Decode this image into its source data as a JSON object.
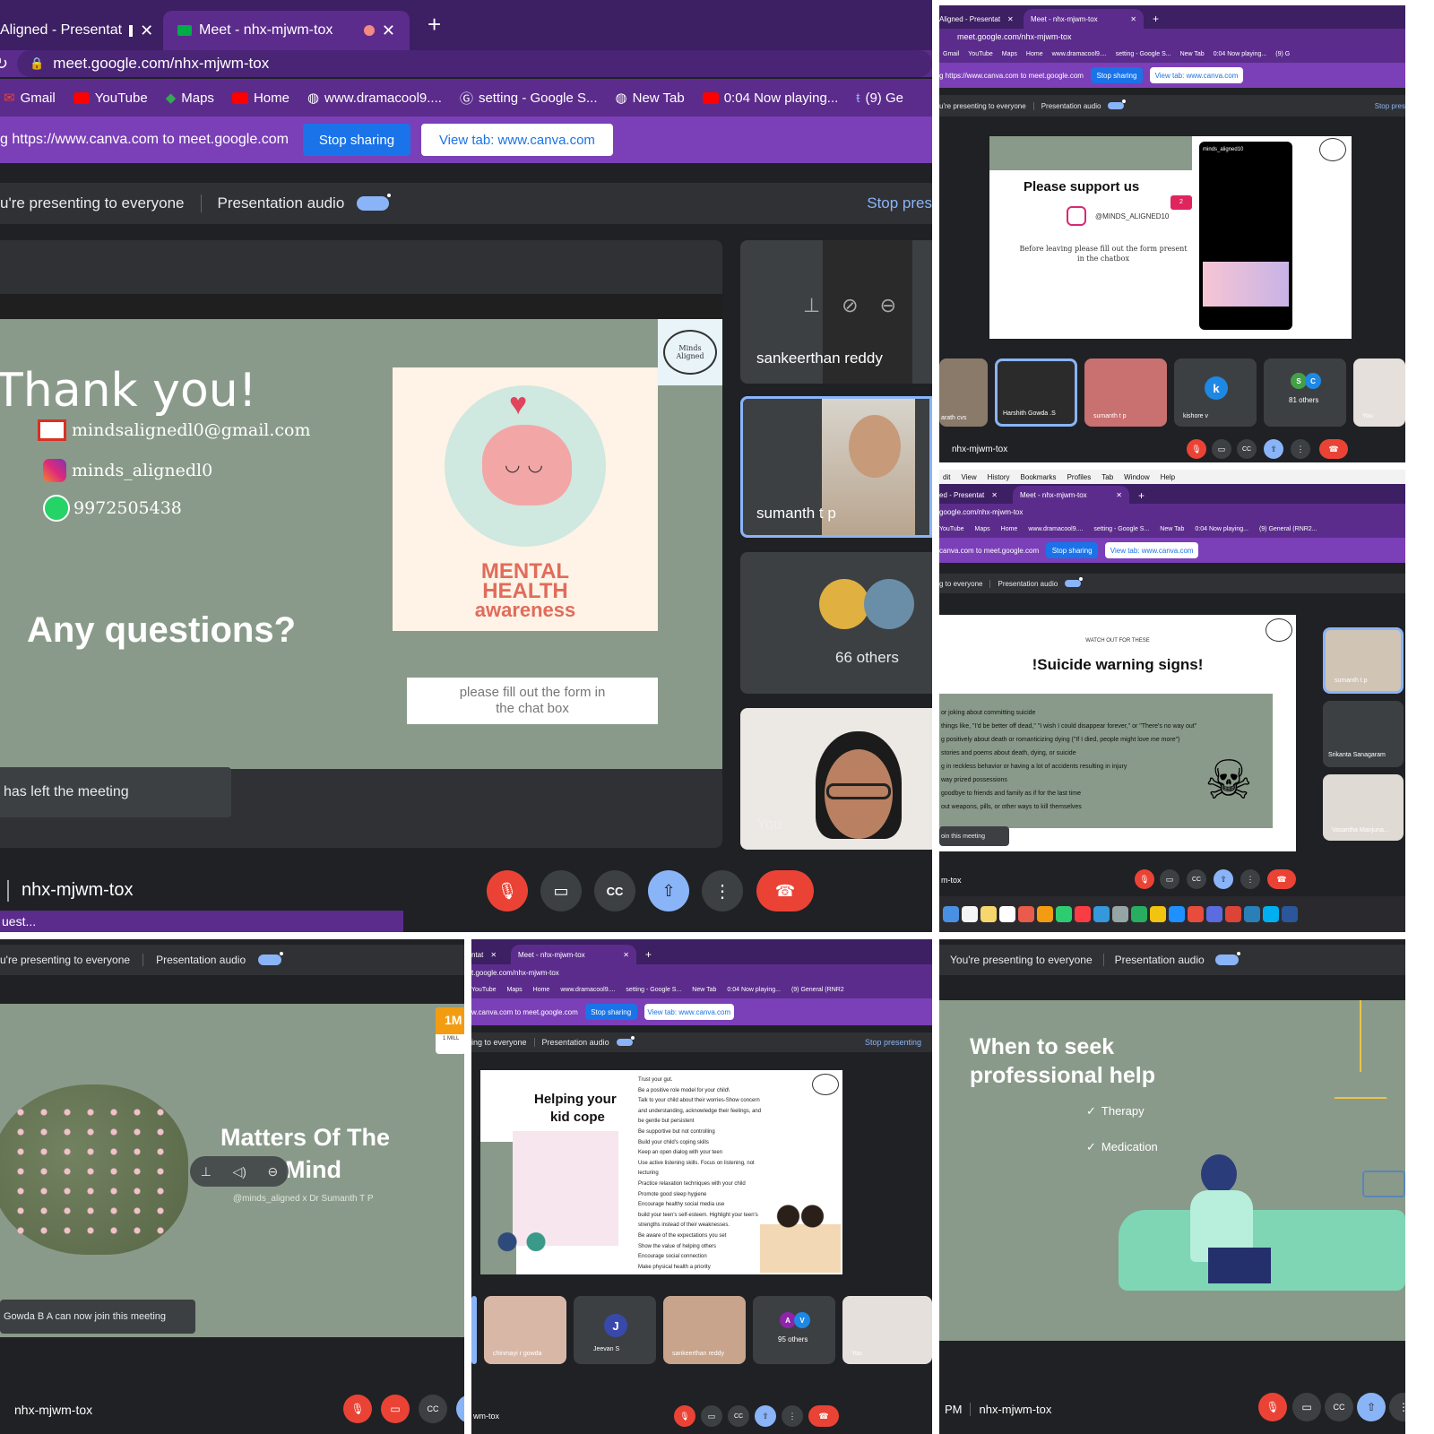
{
  "colors": {
    "purple": "#5b2c8c",
    "meet_dark": "#202124",
    "tile": "#3c4043",
    "slide_green": "#8a9a8a",
    "accent_blue": "#1a73e8",
    "danger_red": "#ea4335"
  },
  "main": {
    "tabs": [
      {
        "label": "Aligned - Presentat",
        "icon": "monitor-icon"
      },
      {
        "label": "Meet - nhx-mjwm-tox",
        "icon": "recording-dot-icon"
      }
    ],
    "new_tab": "+",
    "url": "meet.google.com/nhx-mjwm-tox",
    "bookmarks": [
      "Gmail",
      "YouTube",
      "Maps",
      "Home",
      "www.dramacool9....",
      "setting - Google S...",
      "New Tab",
      "0:04 Now playing...",
      "(9) Ge"
    ],
    "share_text": "g https://www.canva.com to meet.google.com",
    "stop_sharing": "Stop sharing",
    "view_tab": "View tab: www.canva.com",
    "presenting": "u're presenting to everyone",
    "presentation_audio": "Presentation audio",
    "stop_presenting": "Stop pres",
    "slide": {
      "thank_you": "Thank you!",
      "email": "mindsalignedl0@gmail.com",
      "instagram": "minds_alignedl0",
      "phone": "9972505438",
      "questions": "Any questions?",
      "mh_line1": "MENTAL",
      "mh_line2": "HEALTH",
      "mh_line3": "awareness",
      "form_line1": "please fill out the form in",
      "form_line2": "the chat box",
      "logo": "Minds Aligned"
    },
    "toast": "has left the meeting",
    "participants": [
      {
        "name": "sankeerthan reddy"
      },
      {
        "name": "sumanth t p"
      },
      {
        "name": "66 others"
      },
      {
        "name": "You"
      }
    ],
    "meeting_code": "nhx-mjwm-tox",
    "bottom_strip": "uest..."
  },
  "top_right": {
    "tabs": [
      "Aligned - Presentat",
      "Meet - nhx-mjwm-tox"
    ],
    "url": "meet.google.com/nhx-mjwm-tox",
    "bookmarks": [
      "Gmail",
      "YouTube",
      "Maps",
      "Home",
      "www.dramacool9....",
      "setting - Google S...",
      "New Tab",
      "0:04 Now playing...",
      "(9) G"
    ],
    "share_text": "g https://www.canva.com to meet.google.com",
    "stop_sharing": "Stop sharing",
    "view_tab": "View tab: www.canva.com",
    "presenting": "u're presenting to everyone",
    "presentation_audio": "Presentation audio",
    "stop_presenting": "Stop pres",
    "slide_title": "Please support us",
    "handle": "@MINDS_ALIGNED10",
    "note_line1": "Before leaving please fill out the form present",
    "note_line2": "in the chatbox",
    "profile_name": "minds_aligned10",
    "participants": [
      "arath cvs",
      "Harshith Gowda .S",
      "sumanth t p",
      "kishore v",
      "81 others",
      "You"
    ],
    "avatar_k": "k",
    "avatar_s": "S",
    "avatar_c": "C",
    "meeting_code": "nhx-mjwm-tox"
  },
  "mid_right": {
    "menu": [
      "dit",
      "View",
      "History",
      "Bookmarks",
      "Profiles",
      "Tab",
      "Window",
      "Help"
    ],
    "tabs": [
      "ed - Presentat",
      "Meet - nhx-mjwm-tox"
    ],
    "url": "google.com/nhx-mjwm-tox",
    "bookmarks": [
      "YouTube",
      "Maps",
      "Home",
      "www.dramacool9....",
      "setting - Google S...",
      "New Tab",
      "0:04 Now playing...",
      "(9) General (RNR2..."
    ],
    "share_text": "canva.com to meet.google.com",
    "stop_sharing": "Stop sharing",
    "view_tab": "View tab: www.canva.com",
    "presenting": "g to everyone",
    "presentation_audio": "Presentation audio",
    "slide_kicker": "WATCH OUT FOR THESE",
    "slide_title": "!Suicide warning signs!",
    "signs": [
      "or joking about committing suicide",
      "things like, \"I'd be better off dead,\" \"I wish I could disappear forever,\" or \"There's no way out\"",
      "g positively about death or romanticizing dying (\"If I died, people might love me more\")",
      "stories and poems about death, dying, or suicide",
      "g in reckless behavior or having a lot of accidents resulting in injury",
      "way prized possessions",
      "goodbye to friends and family as if for the last time",
      " out weapons, pills, or other ways to kill themselves"
    ],
    "toast": "oin this meeting",
    "participants": [
      "sumanth t p",
      "Srikanta Sanagaram",
      "Vasantha Manjuna..."
    ],
    "meeting_code": "m-tox"
  },
  "bottom_left": {
    "presenting": "u're presenting to everyone",
    "presentation_audio": "Presentation audio",
    "title_line1": "Matters Of The",
    "title_line2": "Mind",
    "subtitle": "@minds_aligned x Dr Sumanth T P",
    "badge_line1": "1M",
    "badge_line2": "1 MILL",
    "toast": "Gowda B A can now join this meeting",
    "meeting_code": "nhx-mjwm-tox"
  },
  "bottom_mid": {
    "tabs": [
      "ntat",
      "Meet - nhx-mjwm-tox"
    ],
    "url": "t.google.com/nhx-mjwm-tox",
    "bookmarks": [
      "YouTube",
      "Maps",
      "Home",
      "www.dramacool9....",
      "setting - Google S...",
      "New Tab",
      "0:04 Now playing...",
      "(9) General (RNR2"
    ],
    "share_text": "w.canva.com to meet.google.com",
    "stop_sharing": "Stop sharing",
    "view_tab": "View tab: www.canva.com",
    "presenting": "ing to everyone",
    "presentation_audio": "Presentation audio",
    "stop_presenting": "Stop presenting",
    "slide_title_line1": "Helping your",
    "slide_title_line2": "kid cope",
    "tips": [
      "Trust your gut.",
      "Be a positive role model for your child\\",
      "Talk to your child about their worries-Show concern",
      "and understanding, acknowledge their feelings, and",
      "be gentle but persistent",
      "Be supportive but not controlling",
      "Build your child's coping skills",
      "Keep an open dialog with your teen",
      "Use active listening skills. Focus on listening, not",
      "lecturing",
      "Practice relaxation techniques with your child",
      "Promote good sleep hygiene",
      "Encourage healthy social media use",
      "build your teen's self-esteem. Highlight your teen's",
      "strengths instead of their weaknesses.",
      "Be aware of the expectations you set",
      "Show the value of helping others",
      " Encourage social connection",
      "Make physical health a priority"
    ],
    "participants": [
      "chinmayi r gowda",
      "Jeevan S",
      "sankeerthan reddy",
      "95 others",
      "You"
    ],
    "avatar_j": "J",
    "avatar_a": "A",
    "avatar_v": "V",
    "meeting_code": "wm-tox"
  },
  "bottom_right": {
    "presenting": "You're presenting to everyone",
    "presentation_audio": "Presentation audio",
    "title_line1": "When to seek",
    "title_line2": "professional help",
    "item1": "Therapy",
    "item2": "Medication",
    "check": "✓",
    "time": "PM",
    "meeting_code": "nhx-mjwm-tox"
  }
}
